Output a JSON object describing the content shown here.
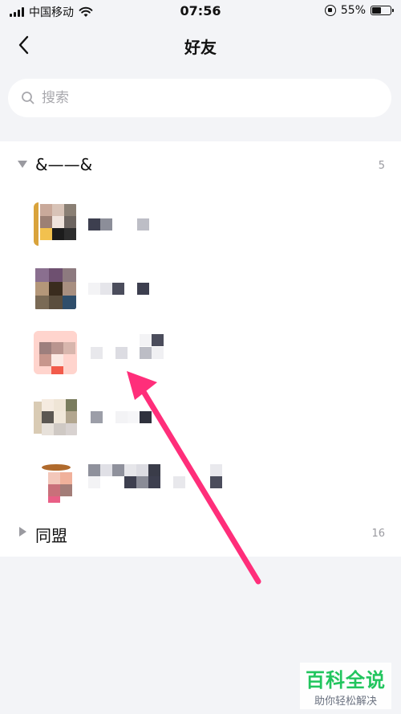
{
  "status_bar": {
    "carrier": "中国移动",
    "time": "07:56",
    "battery_percent": "55%",
    "battery_level": 0.55
  },
  "nav": {
    "title": "好友",
    "back_icon": "chevron-left-icon"
  },
  "search": {
    "placeholder": "搜索",
    "value": ""
  },
  "groups": [
    {
      "name": "&——&",
      "count": "5",
      "expanded": true
    },
    {
      "name": "同盟",
      "count": "16",
      "expanded": false
    }
  ],
  "watermark": {
    "title": "百科全说",
    "subtitle": "助你轻松解决"
  },
  "colors": {
    "accent_arrow": "#ff2e7a",
    "watermark_green": "#22c55e",
    "background": "#f3f4f7"
  }
}
